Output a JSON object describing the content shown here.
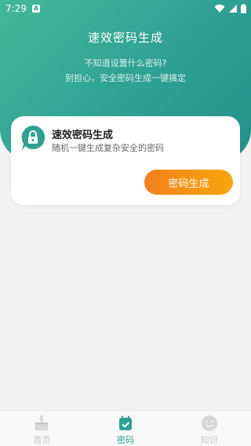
{
  "status_bar": {
    "time": "7:29",
    "notif_letter": "A"
  },
  "hero": {
    "title": "速效密码生成",
    "subtitle_line1": "不知道设置什么密码?",
    "subtitle_line2": "别担心，安全密码生成一键搞定"
  },
  "card": {
    "icon": "lock-chat-icon",
    "title": "速效密码生成",
    "description": "随机一键生成复杂安全的密码",
    "button_label": "密码生成"
  },
  "tabs": [
    {
      "label": "首页",
      "icon": "broom-icon",
      "active": false
    },
    {
      "label": "密码",
      "icon": "calendar-check-icon",
      "active": true
    },
    {
      "label": "知识",
      "icon": "smiley-icon",
      "active": false
    }
  ],
  "colors": {
    "accent": "#2fa091",
    "button_start": "#f47f1c",
    "button_end": "#f8a60f"
  }
}
